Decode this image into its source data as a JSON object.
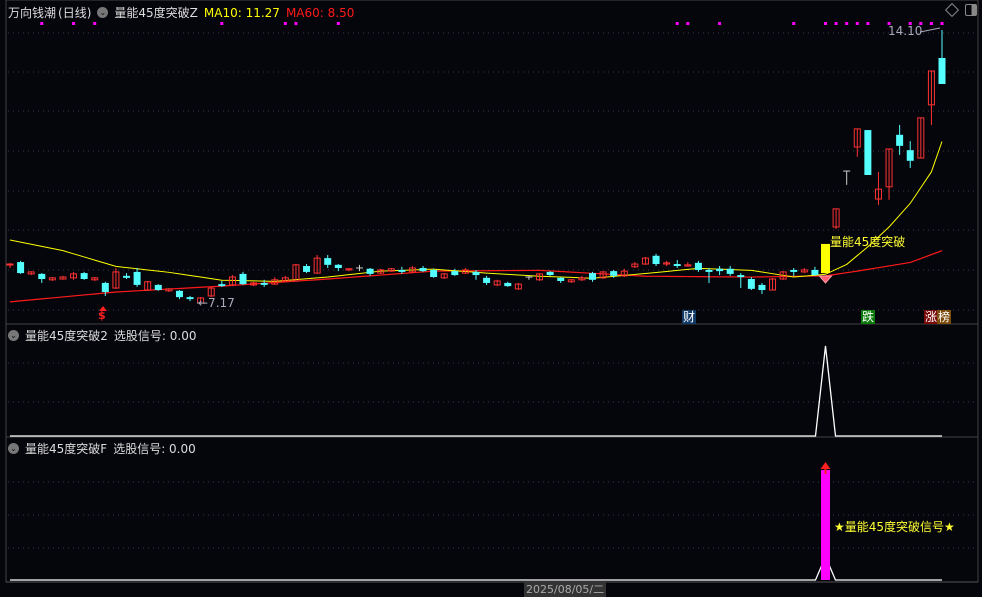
{
  "header": {
    "stock_name": "万向钱潮",
    "period": "(日线)",
    "indicator": "量能45度突破Z",
    "ma10_label": "MA10: 11.27",
    "ma60_label": "MA60: 8.50"
  },
  "panel2": {
    "indicator": "量能45度突破2",
    "signal_label": "选股信号: 0.00"
  },
  "panel3": {
    "indicator": "量能45度突破F",
    "signal_label": "选股信号: 0.00",
    "signal_text": "★量能45度突破信号★"
  },
  "annotations": {
    "high_label": "14.10",
    "low_label": "←7.17",
    "breakout_label": "量能45度突破",
    "dollar_marker": "$",
    "cai_marker": "财",
    "die_marker": "跌",
    "zhang_marker": "涨",
    "bang_marker": "榜"
  },
  "axis": {
    "date_label": "2025/08/05/二"
  },
  "colors": {
    "up": "#ff3232",
    "down": "#54ffff",
    "ma10": "#ffff00",
    "ma60": "#ff1a1a",
    "signal": "#ff00ff",
    "breakout": "#ffff00"
  },
  "icons": {
    "collapse": "chevron-down-icon",
    "diamond": "diamond-icon",
    "window": "window-toggle-icon",
    "gem": "gem-icon"
  },
  "chart_data": {
    "type": "candlestick",
    "price_range": [
      7.17,
      14.1
    ],
    "breakout_index": 77,
    "candles": [
      [
        8.14,
        8.19,
        8.06,
        8.16
      ],
      [
        8.21,
        8.24,
        7.91,
        7.93
      ],
      [
        7.91,
        7.98,
        7.88,
        7.96
      ],
      [
        7.91,
        7.93,
        7.68,
        7.78
      ],
      [
        7.76,
        7.83,
        7.73,
        7.81
      ],
      [
        7.78,
        7.86,
        7.76,
        7.83
      ],
      [
        7.81,
        7.96,
        7.76,
        7.91
      ],
      [
        7.93,
        7.96,
        7.76,
        7.78
      ],
      [
        7.76,
        7.83,
        7.73,
        7.81
      ],
      [
        7.68,
        7.71,
        7.35,
        7.45
      ],
      [
        7.55,
        8.06,
        7.53,
        7.96
      ],
      [
        7.86,
        7.93,
        7.78,
        7.81
      ],
      [
        7.96,
        8.06,
        7.58,
        7.63
      ],
      [
        7.5,
        7.73,
        7.48,
        7.71
      ],
      [
        7.63,
        7.65,
        7.48,
        7.5
      ],
      [
        7.48,
        7.55,
        7.45,
        7.53
      ],
      [
        7.48,
        7.5,
        7.27,
        7.32
      ],
      [
        7.32,
        7.35,
        7.22,
        7.27
      ],
      [
        7.17,
        7.32,
        7.17,
        7.3
      ],
      [
        7.35,
        7.58,
        7.32,
        7.55
      ],
      [
        7.65,
        7.73,
        7.58,
        7.6
      ],
      [
        7.63,
        7.88,
        7.6,
        7.83
      ],
      [
        7.91,
        7.96,
        7.63,
        7.65
      ],
      [
        7.63,
        7.71,
        7.6,
        7.68
      ],
      [
        7.68,
        7.76,
        7.58,
        7.63
      ],
      [
        7.65,
        7.83,
        7.63,
        7.76
      ],
      [
        7.73,
        7.86,
        7.71,
        7.81
      ],
      [
        7.73,
        8.16,
        7.73,
        8.14
      ],
      [
        8.11,
        8.16,
        7.93,
        7.96
      ],
      [
        7.93,
        8.39,
        7.91,
        8.31
      ],
      [
        8.31,
        8.39,
        8.06,
        8.14
      ],
      [
        8.14,
        8.16,
        7.98,
        8.06
      ],
      [
        8.01,
        8.06,
        7.98,
        8.04
      ],
      [
        8.06,
        8.14,
        7.98,
        8.05
      ],
      [
        8.04,
        8.06,
        7.86,
        7.91
      ],
      [
        7.93,
        8.04,
        7.91,
        8.01
      ],
      [
        7.98,
        8.06,
        7.96,
        8.04
      ],
      [
        8.01,
        8.09,
        7.91,
        7.96
      ],
      [
        7.96,
        8.11,
        7.93,
        8.06
      ],
      [
        8.06,
        8.11,
        7.96,
        7.98
      ],
      [
        8.01,
        8.04,
        7.81,
        7.83
      ],
      [
        7.81,
        7.93,
        7.78,
        7.91
      ],
      [
        7.98,
        8.04,
        7.86,
        7.88
      ],
      [
        7.93,
        8.06,
        7.91,
        8.01
      ],
      [
        7.96,
        8.01,
        7.76,
        7.88
      ],
      [
        7.81,
        7.86,
        7.63,
        7.68
      ],
      [
        7.63,
        7.76,
        7.6,
        7.73
      ],
      [
        7.68,
        7.71,
        7.58,
        7.6
      ],
      [
        7.53,
        7.68,
        7.5,
        7.65
      ],
      [
        7.83,
        7.86,
        7.76,
        7.83
      ],
      [
        7.76,
        7.93,
        7.73,
        7.91
      ],
      [
        7.96,
        7.98,
        7.86,
        7.88
      ],
      [
        7.81,
        7.83,
        7.68,
        7.73
      ],
      [
        7.71,
        7.78,
        7.68,
        7.76
      ],
      [
        7.76,
        7.86,
        7.73,
        7.81
      ],
      [
        7.93,
        7.96,
        7.71,
        7.76
      ],
      [
        7.81,
        7.98,
        7.78,
        7.96
      ],
      [
        7.98,
        8.01,
        7.81,
        7.86
      ],
      [
        7.86,
        8.04,
        7.83,
        7.98
      ],
      [
        8.09,
        8.21,
        8.06,
        8.16
      ],
      [
        8.16,
        8.34,
        8.14,
        8.31
      ],
      [
        8.37,
        8.42,
        8.11,
        8.16
      ],
      [
        8.16,
        8.24,
        8.11,
        8.19
      ],
      [
        8.16,
        8.26,
        8.06,
        8.11
      ],
      [
        8.11,
        8.21,
        8.09,
        8.14
      ],
      [
        8.19,
        8.24,
        7.96,
        8.01
      ],
      [
        8.01,
        8.06,
        7.68,
        7.96
      ],
      [
        8.04,
        8.11,
        7.88,
        7.98
      ],
      [
        8.04,
        8.11,
        7.86,
        7.91
      ],
      [
        7.88,
        7.93,
        7.55,
        7.83
      ],
      [
        7.78,
        7.83,
        7.5,
        7.53
      ],
      [
        7.63,
        7.68,
        7.4,
        7.5
      ],
      [
        7.5,
        7.81,
        7.5,
        7.78
      ],
      [
        7.78,
        7.98,
        7.76,
        7.96
      ],
      [
        8.01,
        8.06,
        7.86,
        7.96
      ],
      [
        7.96,
        8.06,
        7.93,
        8.01
      ],
      [
        8.01,
        8.09,
        7.86,
        7.88
      ],
      [
        7.93,
        8.67,
        7.93,
        8.67
      ],
      [
        9.1,
        9.56,
        9.05,
        9.56
      ],
      [
        10.52,
        10.52,
        10.17,
        10.52
      ],
      [
        11.13,
        11.59,
        10.88,
        11.59
      ],
      [
        11.56,
        11.56,
        10.42,
        10.42
      ],
      [
        9.81,
        10.5,
        9.66,
        10.06
      ],
      [
        10.12,
        11.08,
        9.79,
        11.08
      ],
      [
        11.44,
        11.69,
        10.93,
        11.16
      ],
      [
        11.05,
        11.28,
        10.6,
        10.78
      ],
      [
        10.85,
        11.87,
        10.85,
        11.87
      ],
      [
        12.2,
        13.06,
        11.69,
        13.06
      ],
      [
        13.39,
        14.1,
        12.73,
        12.73
      ]
    ],
    "ma10_points": [
      [
        0,
        8.77
      ],
      [
        5,
        8.5
      ],
      [
        10,
        8.1
      ],
      [
        15,
        7.95
      ],
      [
        20,
        7.75
      ],
      [
        25,
        7.72
      ],
      [
        30,
        7.83
      ],
      [
        35,
        7.98
      ],
      [
        40,
        8.03
      ],
      [
        45,
        7.93
      ],
      [
        50,
        7.85
      ],
      [
        55,
        7.8
      ],
      [
        60,
        7.92
      ],
      [
        65,
        8.05
      ],
      [
        70,
        8.0
      ],
      [
        74,
        7.83
      ],
      [
        77,
        7.9
      ],
      [
        79,
        8.15
      ],
      [
        81,
        8.6
      ],
      [
        83,
        9.1
      ],
      [
        85,
        9.7
      ],
      [
        87,
        10.5
      ],
      [
        88,
        11.27
      ]
    ],
    "ma60_points": [
      [
        0,
        7.2
      ],
      [
        10,
        7.45
      ],
      [
        20,
        7.6
      ],
      [
        30,
        7.78
      ],
      [
        40,
        7.98
      ],
      [
        50,
        8.0
      ],
      [
        60,
        7.85
      ],
      [
        70,
        7.83
      ],
      [
        77,
        7.86
      ],
      [
        80,
        7.98
      ],
      [
        85,
        8.2
      ],
      [
        88,
        8.5
      ]
    ],
    "top_signal_indices": [
      3,
      6,
      8,
      20,
      26,
      27,
      31,
      63,
      64,
      67,
      74,
      77,
      78,
      79,
      80,
      81,
      83,
      85,
      86,
      87,
      88
    ],
    "panel2_signal": {
      "index": 77,
      "value": 1,
      "range": [
        0,
        1
      ]
    },
    "panel3_signal": {
      "index": 77,
      "value": 1,
      "range": [
        0,
        1
      ]
    }
  }
}
